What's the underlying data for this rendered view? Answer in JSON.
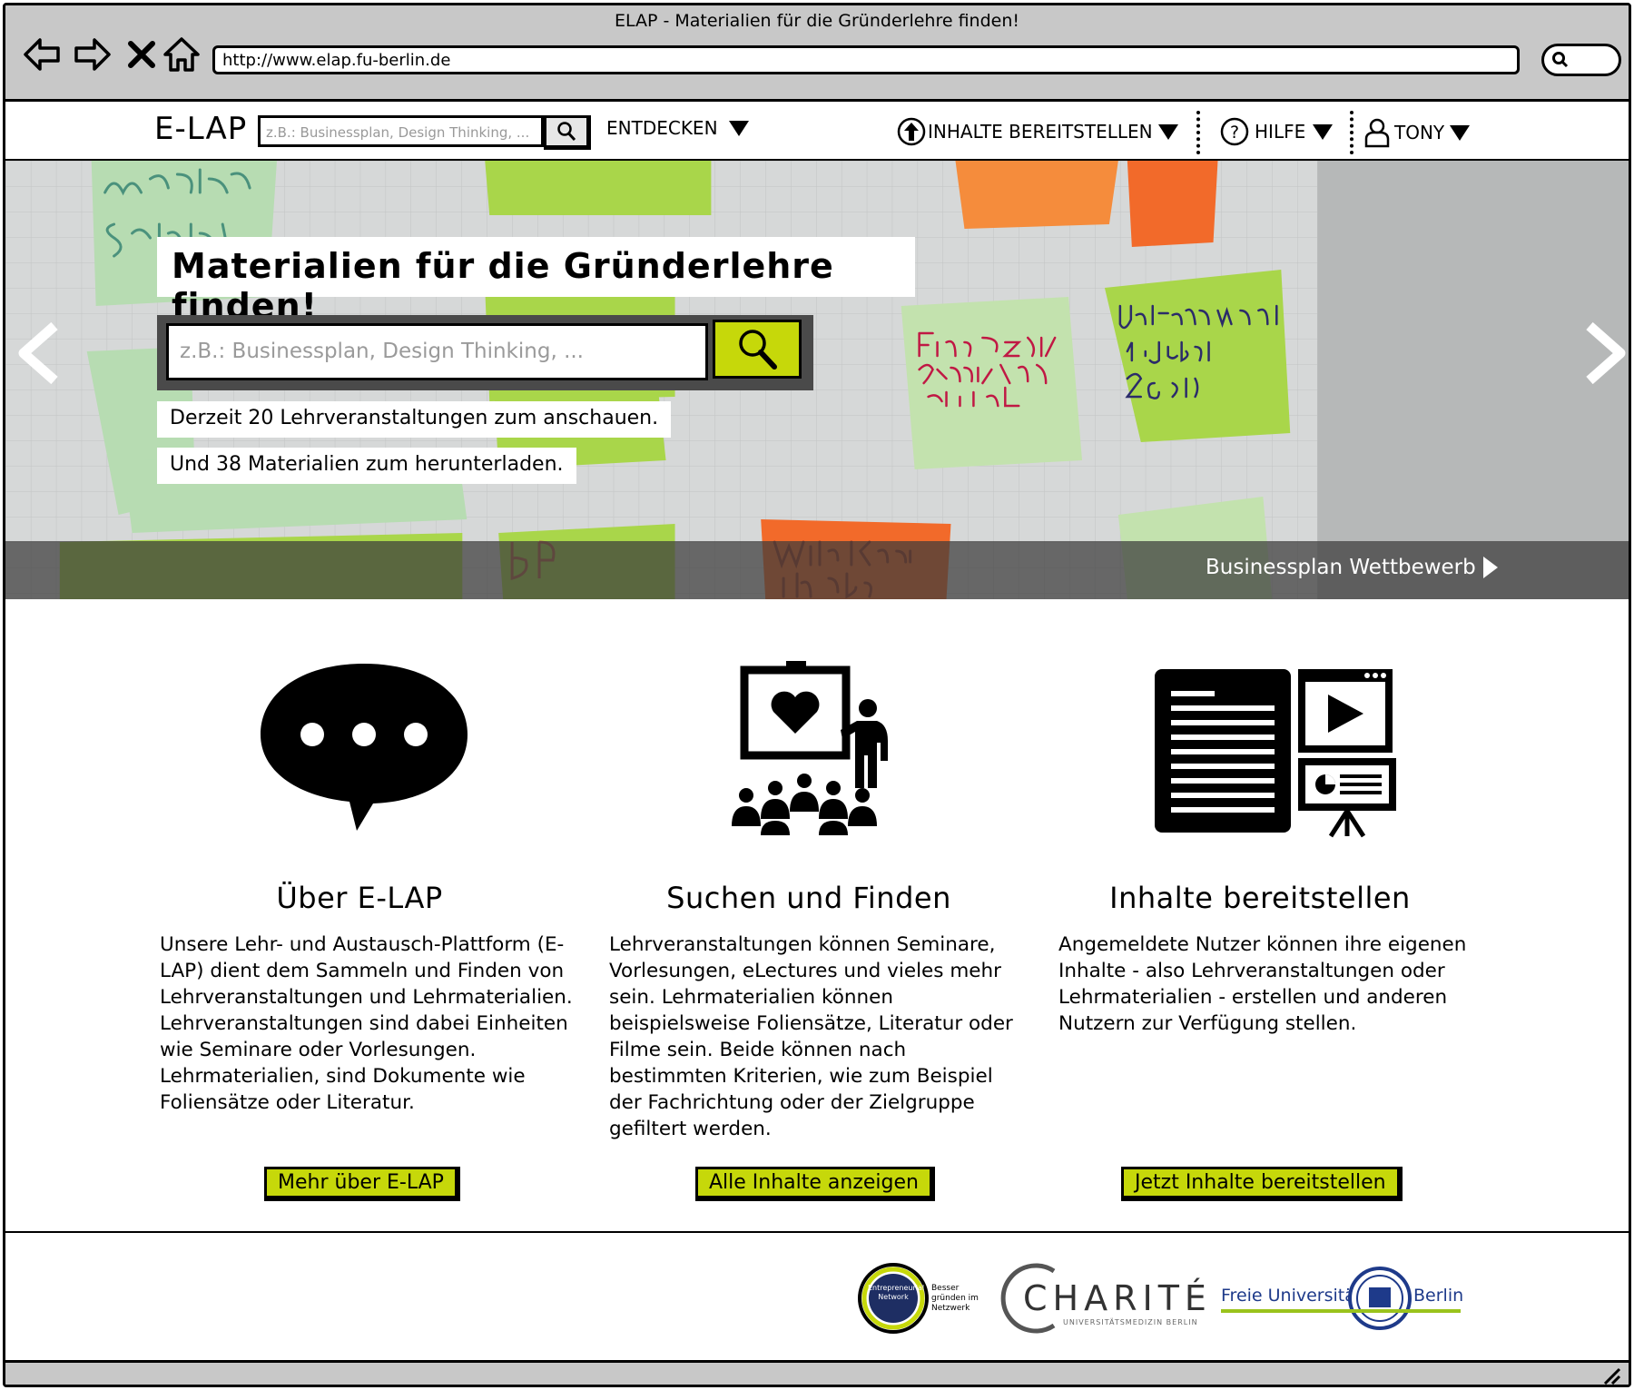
{
  "browser": {
    "window_title": "ELAP - Materialien für die Gründerlehre finden!",
    "url": "http://www.elap.fu-berlin.de"
  },
  "header": {
    "logo": "E-LAP",
    "search_placeholder": "z.B.: Businessplan, Design Thinking, ...",
    "menu": {
      "entdecken": "ENTDECKEN",
      "inhalte": "INHALTE BEREITSTELLEN",
      "hilfe": "HILFE",
      "user": "TONY"
    }
  },
  "hero": {
    "title": "Materialien für die Gründerlehre finden!",
    "search_placeholder": "z.B.: Businessplan, Design Thinking, ...",
    "info_courses": "Derzeit 20 Lehrveranstaltungen zum anschauen.",
    "info_materials": "Und 38 Materialien zum herunterladen.",
    "link": "Businessplan Wettbewerb"
  },
  "features": [
    {
      "title": "Über E-LAP",
      "text": "Unsere Lehr- und Austausch-Plattform (E-LAP) dient dem Sammeln und Finden von Lehrveranstaltungen und Lehrmaterialien. Lehrveranstaltungen sind dabei Einheiten wie Seminare oder Vorlesungen. Lehrmaterialien, sind Dokumente wie Foliensätze oder Literatur.",
      "button": "Mehr über E-LAP"
    },
    {
      "title": "Suchen und Finden",
      "text": "Lehrveranstaltungen können Seminare, Vorlesungen, eLectures und vieles mehr sein. Lehrmaterialien können beispielsweise Foliensätze, Literatur oder Filme sein.  Beide können nach bestimmten Kriterien, wie zum Beispiel der Fachrichtung oder der Zielgruppe gefiltert werden.",
      "button": "Alle Inhalte anzeigen"
    },
    {
      "title": "Inhalte bereitstellen",
      "text": "Angemeldete Nutzer können ihre eigenen Inhalte - also Lehrveranstaltungen oder Lehrmaterialien - erstellen und anderen Nutzern zur Verfügung stellen.",
      "button": "Jetzt Inhalte bereitstellen"
    }
  ],
  "footer": {
    "logo_network_inner": "Entrepreneurial Network",
    "logo_network_side": "Besser gründen im Netzwerk",
    "logo_charite": "CHARITÉ",
    "logo_charite_sub": "UNIVERSITÄTSMEDIZIN BERLIN",
    "logo_fu_left": "Freie Universität",
    "logo_fu_right": "Berlin"
  }
}
